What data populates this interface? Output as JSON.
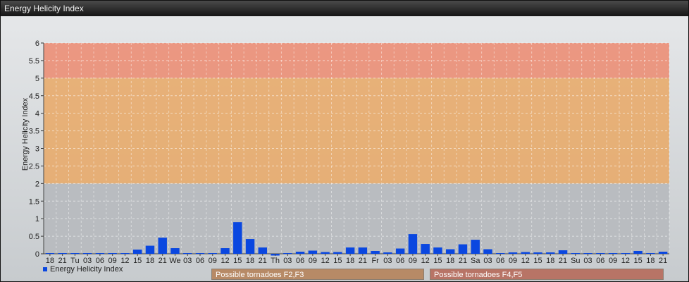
{
  "window": {
    "title": "Energy Helicity Index"
  },
  "chart_data": {
    "type": "bar",
    "title": "",
    "xlabel": "",
    "ylabel": "Energy Helicity Index",
    "ylim": [
      0,
      6
    ],
    "yticks": [
      "0",
      "0.5",
      "1",
      "1.5",
      "2",
      "2.5",
      "3",
      "3.5",
      "4",
      "4.5",
      "5",
      "5.5",
      "6"
    ],
    "categories": [
      "18",
      "21",
      "Tu",
      "03",
      "06",
      "09",
      "12",
      "15",
      "18",
      "21",
      "We",
      "03",
      "06",
      "09",
      "12",
      "15",
      "18",
      "21",
      "Th",
      "03",
      "06",
      "09",
      "12",
      "15",
      "18",
      "21",
      "Fr",
      "03",
      "06",
      "09",
      "12",
      "15",
      "18",
      "21",
      "Sa",
      "03",
      "06",
      "09",
      "12",
      "15",
      "18",
      "21",
      "Su",
      "03",
      "06",
      "09",
      "12",
      "15",
      "18",
      "21"
    ],
    "series": [
      {
        "name": "Energy Helicity Index",
        "color": "#0a47e0",
        "values": [
          0.02,
          0.02,
          0.02,
          0.02,
          0.02,
          0.02,
          0.02,
          0.12,
          0.23,
          0.46,
          0.16,
          0.02,
          0.02,
          0.02,
          0.16,
          0.9,
          0.42,
          0.18,
          -0.05,
          0.02,
          0.06,
          0.09,
          0.05,
          0.05,
          0.18,
          0.18,
          0.08,
          0.04,
          0.15,
          0.56,
          0.28,
          0.18,
          0.13,
          0.27,
          0.4,
          0.13,
          0.02,
          0.04,
          0.05,
          0.04,
          0.04,
          0.1,
          0.02,
          0.02,
          0.02,
          0.02,
          0.02,
          0.08,
          0.02,
          0.06
        ]
      }
    ],
    "bands": [
      {
        "from": 2,
        "to": 5,
        "color": "#e9a865"
      },
      {
        "from": 5,
        "to": 6,
        "color": "#ec8a70"
      }
    ],
    "zone_labels": [
      {
        "label": "Possible tornadoes F2,F3",
        "color": "#b78a66"
      },
      {
        "label": "Possible tornadoes F4,F5",
        "color": "#b87466"
      }
    ],
    "grid": true,
    "legend": "bottom-left"
  }
}
